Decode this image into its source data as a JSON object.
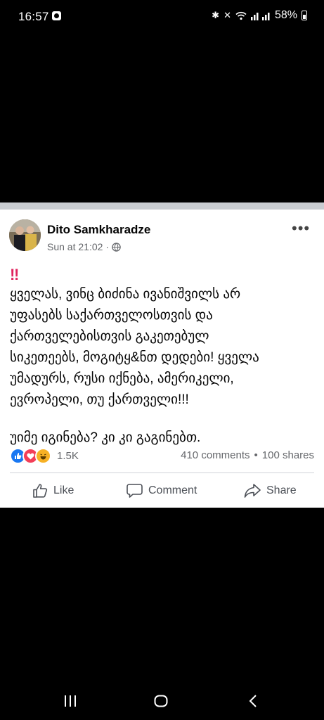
{
  "status_bar": {
    "time": "16:57",
    "battery": "58%"
  },
  "post": {
    "author": "Dito Samkharadze",
    "timestamp": "Sun at 21:02",
    "bangbang": "‼",
    "lines": [
      "ყველას, ვინც ბიძინა ივანიშვილს არ",
      "უფასებს საქართველოსთვის და",
      "ქართველებისთვის გაკეთებულ",
      "სიკეთეებს, მოგიტყ&ნთ დედები! ყველა",
      "უმადურს, რუსი იქნება, ამერიკელი,",
      "ევროპელი, თუ  ქართველი!!!"
    ],
    "closing_line": "უიმე იგინება? კი კი გაგინებთ.",
    "reaction_count": "1.5K",
    "comments": "410 comments",
    "separator": "•",
    "shares": "100 shares"
  },
  "actions": {
    "like": "Like",
    "comment": "Comment",
    "share": "Share"
  },
  "icons": {
    "privacy": "globe-icon",
    "more": "more-options-icon",
    "reactions": [
      "like-icon",
      "love-icon",
      "haha-icon"
    ]
  },
  "colors": {
    "facebook_blue": "#1877f2",
    "love_red": "#f33e58",
    "haha_yellow": "#f7b125",
    "secondary_text": "#65676b"
  }
}
